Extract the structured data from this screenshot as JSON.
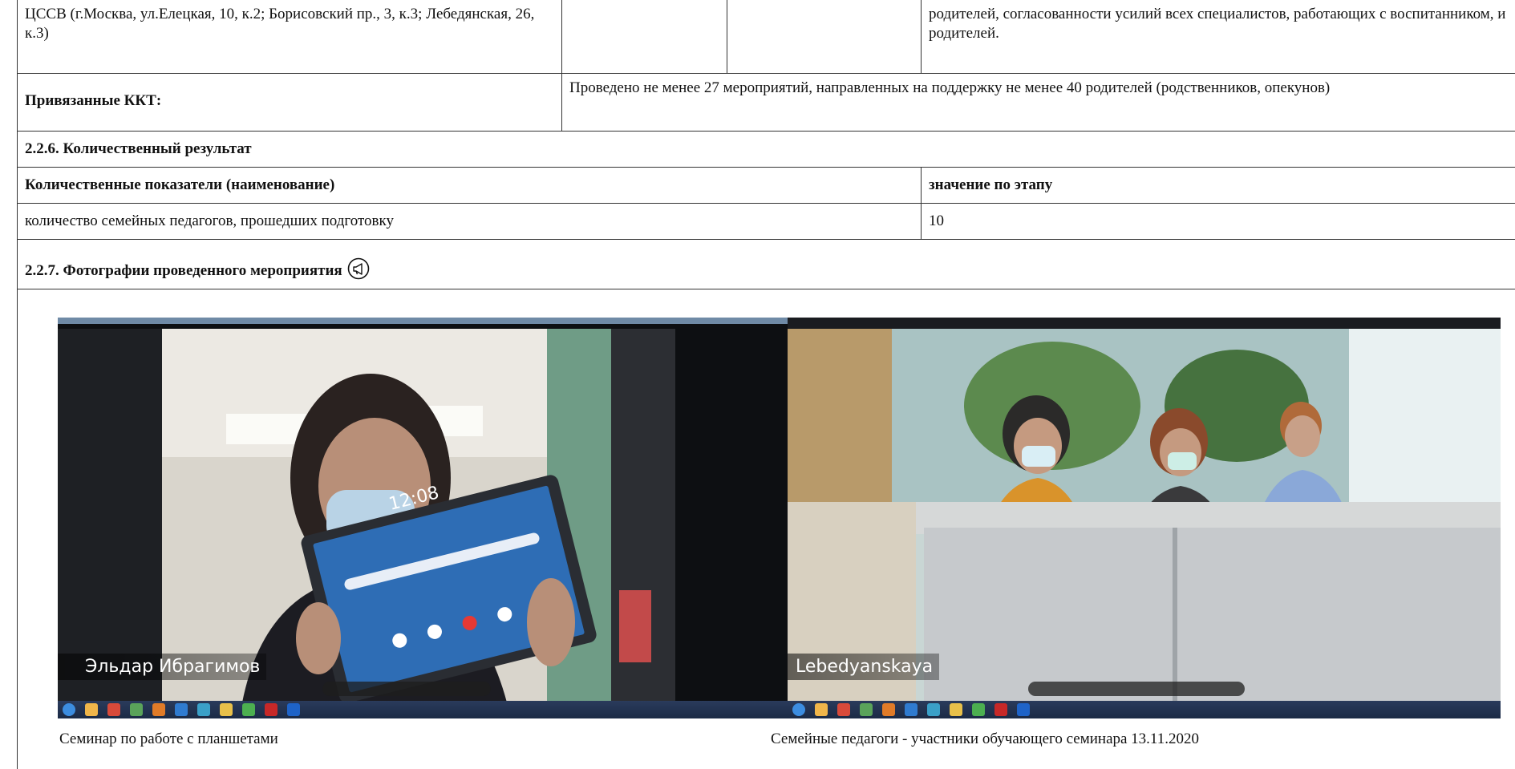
{
  "rows": {
    "r1": {
      "c1": "ЦССВ (г.Москва, ул.Елецкая, 10, к.2; Борисовский пр., 3, к.3; Лебедянская, 26, к.3)",
      "c2": "",
      "c3": "",
      "c4": "родителей, согласованности усилий всех специалистов, работающих с воспитанником, и родителей."
    },
    "kkt": {
      "label": "Привязанные ККТ:",
      "value": "Проведено не менее 27 мероприятий, направленных на поддержку не менее 40 родителей (родственников, опекунов)"
    },
    "quant_header": "2.2.6. Количественный результат",
    "quant_columns": {
      "name": "Количественные показатели (наименование)",
      "value": "значение по этапу"
    },
    "quant_row": {
      "name": "количество семейных педагогов, прошедших подготовку",
      "value": "10"
    },
    "photos_header": "2.2.7. Фотографии проведенного мероприятия"
  },
  "photos": [
    {
      "caption": "Семинар по работе с планшетами",
      "overlay_name": "Эльдар Ибрагимов",
      "screen_time": "12:08"
    },
    {
      "caption": "Семейные педагоги - участники обучающего семинара 13.11.2020",
      "overlay_name": "Lebedyanskaya"
    }
  ],
  "icons": {
    "photos_header_icon": "megaphone-icon"
  },
  "colors": {
    "border": "#333333",
    "text": "#111111"
  }
}
